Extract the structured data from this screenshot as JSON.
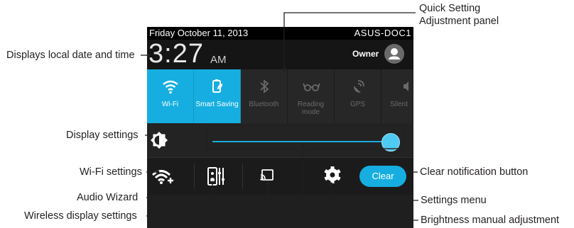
{
  "status_bar": {
    "date": "Friday October 11, 2013",
    "device": "ASUS-DOC1"
  },
  "header": {
    "time": "3:27",
    "ampm": "AM",
    "owner": "Owner",
    "avatar_icon": "person-icon"
  },
  "tiles": [
    {
      "label": "Wi-Fi",
      "icon": "wifi-icon",
      "active": true
    },
    {
      "label": "Smart Saving",
      "icon": "smart-saving-icon",
      "active": true
    },
    {
      "label": "Bluetooth",
      "icon": "bluetooth-icon",
      "active": false
    },
    {
      "label": "Reading mode",
      "icon": "reading-mode-icon",
      "active": false
    },
    {
      "label": "GPS",
      "icon": "gps-icon",
      "active": false
    },
    {
      "label": "Silent",
      "icon": "silent-icon",
      "active": false
    }
  ],
  "brightness": {
    "icon": "brightness-icon",
    "level_fraction": 1.0
  },
  "bottom_bar": {
    "clear_label": "Clear"
  },
  "annotations": {
    "quick_setting_panel": "Quick Setting\nAdjustment panel",
    "local_date_time": "Displays local date and time",
    "display_settings": "Display settings",
    "wifi_settings": "Wi-Fi settings",
    "audio_wizard": "Audio Wizard",
    "wireless_display": "Wireless display settings",
    "clear_notification": "Clear notification button",
    "settings_menu": "Settings menu",
    "brightness_manual": "Brightness manual adjustment"
  },
  "colors": {
    "accent": "#16aee0",
    "panel_bg": "#1f1f1f",
    "label_text": "#231f20"
  }
}
